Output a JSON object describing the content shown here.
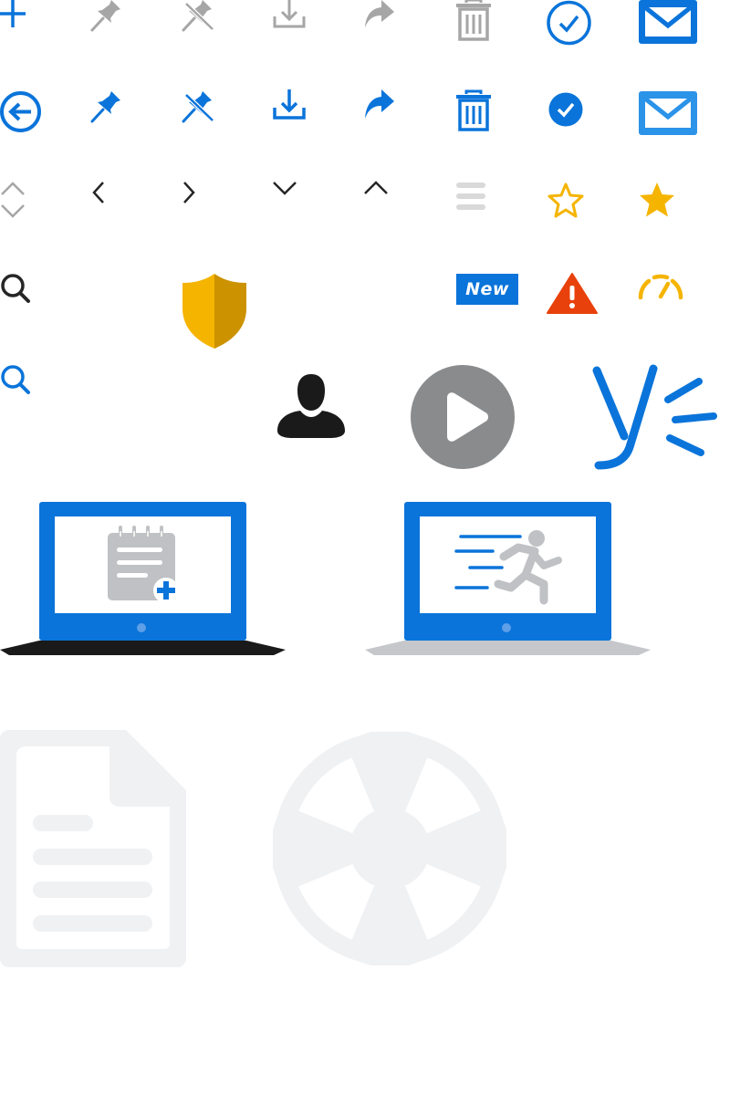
{
  "colors": {
    "blue": "#0a74da",
    "light_blue": "#2b93e8",
    "gray": "#a6a6a6",
    "dark": "#262626",
    "yellow": "#f5b400",
    "alert_red": "#e8410b",
    "pale": "#f0f1f3"
  },
  "icons": {
    "row1": [
      "plus-icon",
      "pin-icon",
      "unpin-icon",
      "download-icon",
      "forward-icon",
      "trash-icon",
      "check-circle-outline-icon",
      "mail-icon"
    ],
    "row2": [
      "back-circle-icon",
      "pin-icon",
      "unpin-icon",
      "download-icon",
      "forward-icon",
      "trash-icon",
      "check-circle-filled-icon",
      "mail-icon"
    ],
    "row3": [
      "sort-icon",
      "chevron-left-icon",
      "chevron-right-icon",
      "chevron-down-icon",
      "chevron-up-icon",
      "drag-handle-icon",
      "star-outline-icon",
      "star-filled-icon"
    ],
    "row4": [
      "search-icon",
      "shield-icon",
      "warning-icon",
      "gauge-icon"
    ],
    "row5": [
      "search-icon",
      "user-icon",
      "play-icon",
      "yammer-logo-icon"
    ],
    "illustrations": [
      "laptop-note-add-icon",
      "laptop-runner-icon",
      "document-icon",
      "lifebuoy-icon"
    ]
  },
  "badge": {
    "label": "New"
  }
}
